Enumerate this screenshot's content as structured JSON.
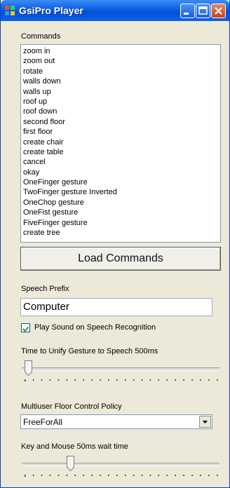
{
  "window": {
    "title": "GsiPro Player"
  },
  "commands": {
    "label": "Commands",
    "items": [
      "zoom in",
      "zoom out",
      "rotate",
      "walls down",
      "walls up",
      "roof up",
      "roof down",
      "second floor",
      "first floor",
      "create chair",
      "create table",
      "cancel",
      "okay",
      "OneFinger gesture",
      "TwoFinger gesture Inverted",
      "OneChop gesture",
      "OneFist gesture",
      "FiveFinger gesture",
      "create tree"
    ]
  },
  "load_button": {
    "label": "Load Commands"
  },
  "speech": {
    "label": "Speech Prefix",
    "value": "Computer"
  },
  "play_sound": {
    "label": "Play Sound on Speech Recognition",
    "checked": true
  },
  "unify_slider": {
    "label": "Time to Unify Gesture to Speech 500ms",
    "position": 0.02
  },
  "floor_policy": {
    "label": "Multiuser Floor Control Policy",
    "selected": "FreeForAll"
  },
  "wait_slider": {
    "label": "Key and Mouse 50ms wait time",
    "position": 0.24
  },
  "colors": {
    "titlebar": "#0a5fe0",
    "close_button": "#c8421c",
    "window_bg": "#ece9d8"
  }
}
